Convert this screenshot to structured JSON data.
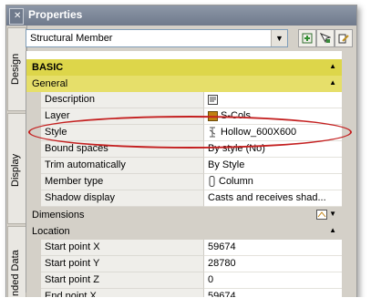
{
  "panel": {
    "title": "Properties",
    "grip_glyph": "✕",
    "side_tabs": [
      "Design",
      "Display",
      "nded Data"
    ]
  },
  "header": {
    "object_type": "Structural Member",
    "buttons": [
      "add-icon",
      "select-objects-icon",
      "edit-icon"
    ]
  },
  "grid": {
    "category_basic": "BASIC",
    "category_general": "General",
    "rows_general": [
      {
        "name": "Description",
        "value": "",
        "icon": "description-editor-icon"
      },
      {
        "name": "Layer",
        "value": "S-Cols",
        "icon": "layer-color-icon"
      },
      {
        "name": "Style",
        "value": "Hollow_600X600",
        "icon": "style-icon"
      },
      {
        "name": "Bound spaces",
        "value": "By style (No)"
      },
      {
        "name": "Trim automatically",
        "value": "By Style"
      },
      {
        "name": "Member type",
        "value": "Column",
        "icon": "column-icon"
      },
      {
        "name": "Shadow display",
        "value": "Casts and receives shad..."
      }
    ],
    "category_dimensions": "Dimensions",
    "category_location": "Location",
    "rows_location": [
      {
        "name": "Start point X",
        "value": "59674"
      },
      {
        "name": "Start point Y",
        "value": "28780"
      },
      {
        "name": "Start point Z",
        "value": "0"
      },
      {
        "name": "End point X",
        "value": "59674"
      }
    ]
  },
  "colors": {
    "highlight": "#ddd64a",
    "annotation_ring": "#c42020"
  }
}
